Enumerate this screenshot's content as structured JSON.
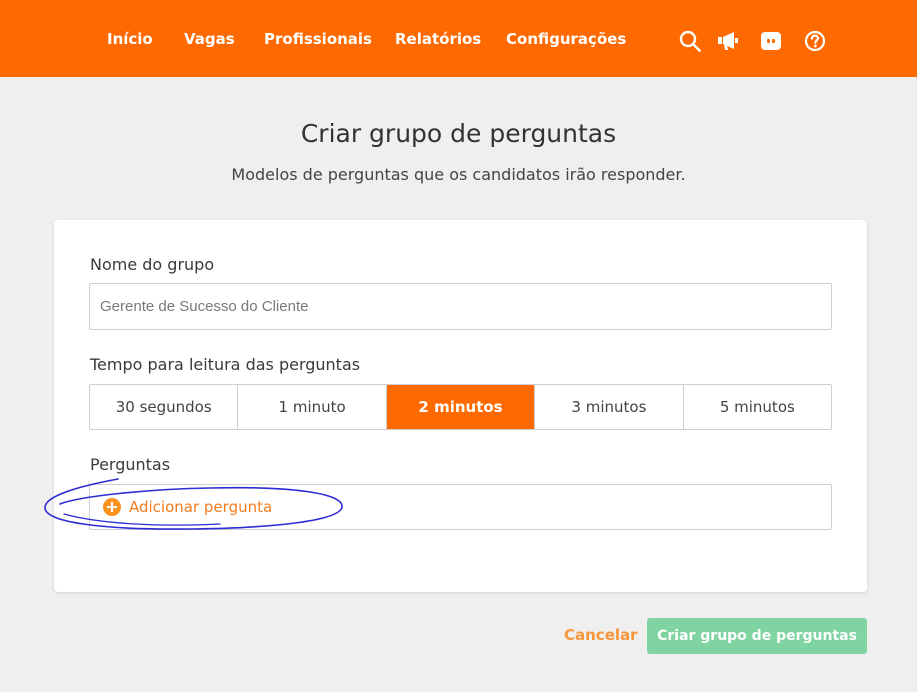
{
  "nav": {
    "items": [
      {
        "label": "Início"
      },
      {
        "label": "Vagas"
      },
      {
        "label": "Profissionais"
      },
      {
        "label": "Relatórios"
      },
      {
        "label": "Configurações"
      }
    ],
    "icons": [
      "search-icon",
      "megaphone-icon",
      "chat-icon",
      "help-icon"
    ]
  },
  "header": {
    "title": "Criar grupo de perguntas",
    "subtitle": "Modelos de perguntas que os candidatos irão responder."
  },
  "form": {
    "group_name_label": "Nome do grupo",
    "group_name_placeholder": "Gerente de Sucesso do Cliente",
    "group_name_value": "",
    "reading_time_label": "Tempo para leitura das perguntas",
    "reading_time_options": [
      "30 segundos",
      "1 minuto",
      "2 minutos",
      "3 minutos",
      "5 minutos"
    ],
    "reading_time_selected": "2 minutos",
    "questions_label": "Perguntas",
    "add_question_label": "Adicionar pergunta"
  },
  "actions": {
    "cancel_label": "Cancelar",
    "submit_label": "Criar grupo de perguntas"
  },
  "colors": {
    "brand": "#ff6a00",
    "accent_orange": "#f7931e",
    "submit_green": "#7fd4a1",
    "annotation": "#2d2bd4"
  }
}
